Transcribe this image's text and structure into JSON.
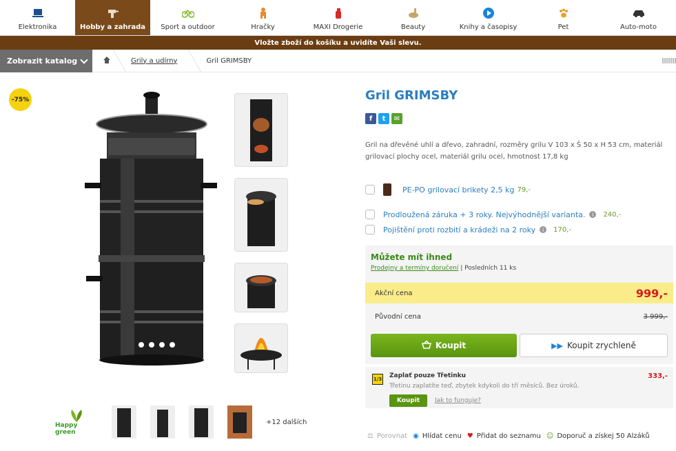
{
  "nav": {
    "categories": [
      {
        "label": "Elektronika",
        "icon": "laptop-icon",
        "active": false
      },
      {
        "label": "Hobby a zahrada",
        "icon": "drill-icon",
        "active": true
      },
      {
        "label": "Sport a outdoor",
        "icon": "bike-icon",
        "active": false
      },
      {
        "label": "Hračky",
        "icon": "toy-icon",
        "active": false
      },
      {
        "label": "MAXI Drogerie",
        "icon": "spray-icon",
        "active": false
      },
      {
        "label": "Beauty",
        "icon": "cosmetics-icon",
        "active": false
      },
      {
        "label": "Knihy a časopisy",
        "icon": "play-icon",
        "active": false
      },
      {
        "label": "Pet",
        "icon": "paw-icon",
        "active": false
      },
      {
        "label": "Auto-moto",
        "icon": "car-icon",
        "active": false
      }
    ]
  },
  "promo": "Vložte zboží do košíku a uvidíte Vaši slevu.",
  "breadcrumb": {
    "catalog": "Zobrazit katalog",
    "items": [
      "Grily a udírny",
      "Gril GRIMSBY"
    ]
  },
  "gallery": {
    "discount": "-75%",
    "brand_label": "Happy green",
    "more": "+12 dalších"
  },
  "product": {
    "title": "Gril GRIMSBY",
    "description": "Gril na dřevěné uhlí a dřevo, zahradní, rozměry grilu V 103 x Š 50 x H 53 cm, materiál grilovací plochy ocel, materiál grilu ocel, hmotnost 17,8 kg",
    "options": [
      {
        "label": "PE-PO grilovací brikety 2,5 kg",
        "price": "79,-"
      },
      {
        "label": "Prodloužená záruka + 3 roky. Nejvýhodnější varianta.",
        "price": "240,-"
      },
      {
        "label": "Pojištění proti rozbití a krádeži na 2 roky",
        "price": "170,-"
      }
    ],
    "availability": {
      "title": "Můžete mít ihned",
      "link": "Prodejny a termíny doručení",
      "stock": "Posledních 11 ks"
    },
    "action_price": {
      "label": "Akční cena",
      "value": "999,-"
    },
    "original_price": {
      "label": "Původní cena",
      "value": "3 999,-"
    },
    "buy_label": "Koupit",
    "buy_fast_label": "Koupit zrychleně",
    "third": {
      "badge": "1/3",
      "title": "Zaplať pouze Třetinku",
      "price": "333,-",
      "text": "Třetinu zaplatíte teď, zbytek kdykoli do tří měsíců. Bez úroků.",
      "button": "Koupit",
      "how": "Jak to funguje?"
    },
    "actions": [
      "Porovnat",
      "Hlídat cenu",
      "Přidat do seznamu",
      "Doporuč a získej 50 Alzáků"
    ]
  },
  "colors": {
    "brand": "#7a4a1a",
    "link": "#2a7ec0",
    "green": "#5a9410",
    "price_red": "#d61a1a",
    "highlight": "#fbec8a"
  }
}
